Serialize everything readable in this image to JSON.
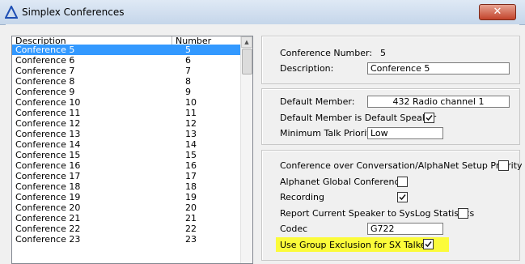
{
  "window": {
    "title": "Simplex Conferences",
    "close_glyph": "✕"
  },
  "list": {
    "columns": [
      "Description",
      "Number"
    ],
    "rows": [
      {
        "description": "Conference 5",
        "number": "5",
        "selected": true
      },
      {
        "description": "Conference 6",
        "number": "6"
      },
      {
        "description": "Conference 7",
        "number": "7"
      },
      {
        "description": "Conference 8",
        "number": "8"
      },
      {
        "description": "Conference 9",
        "number": "9"
      },
      {
        "description": "Conference 10",
        "number": "10"
      },
      {
        "description": "Conference 11",
        "number": "11"
      },
      {
        "description": "Conference 12",
        "number": "12"
      },
      {
        "description": "Conference 13",
        "number": "13"
      },
      {
        "description": "Conference 14",
        "number": "14"
      },
      {
        "description": "Conference 15",
        "number": "15"
      },
      {
        "description": "Conference 16",
        "number": "16"
      },
      {
        "description": "Conference 17",
        "number": "17"
      },
      {
        "description": "Conference 18",
        "number": "18"
      },
      {
        "description": "Conference 19",
        "number": "19"
      },
      {
        "description": "Conference 20",
        "number": "20"
      },
      {
        "description": "Conference 21",
        "number": "21"
      },
      {
        "description": "Conference 22",
        "number": "22"
      },
      {
        "description": "Conference 23",
        "number": "23"
      }
    ]
  },
  "details": {
    "conference_number_label": "Conference Number:",
    "conference_number_value": "5",
    "description_label": "Description:",
    "description_value": "Conference 5"
  },
  "member": {
    "default_member_label": "Default Member:",
    "default_member_value": "432 Radio channel 1",
    "default_speaker_label": "Default Member is Default Speaker",
    "default_speaker_checked": true,
    "min_priority_label": "Minimum Talk Priority",
    "min_priority_value": "Low"
  },
  "options": {
    "over_conversation_label": "Conference over Conversation/AlphaNet Setup Priority",
    "over_conversation_checked": false,
    "global_label": "Alphanet Global Conference",
    "global_checked": false,
    "recording_label": "Recording",
    "recording_checked": true,
    "report_label": "Report Current Speaker to SysLog Statistics",
    "report_checked": false,
    "codec_label": "Codec",
    "codec_value": "G722",
    "group_exclusion_label": "Use Group Exclusion for SX Talker",
    "group_exclusion_checked": true
  },
  "colors": {
    "selection": "#3399ff",
    "highlight": "#fbfb3a",
    "title_accent": "#1f4fb4"
  },
  "icons": {
    "app": "triangle-app-icon",
    "check": "checkmark-icon"
  }
}
